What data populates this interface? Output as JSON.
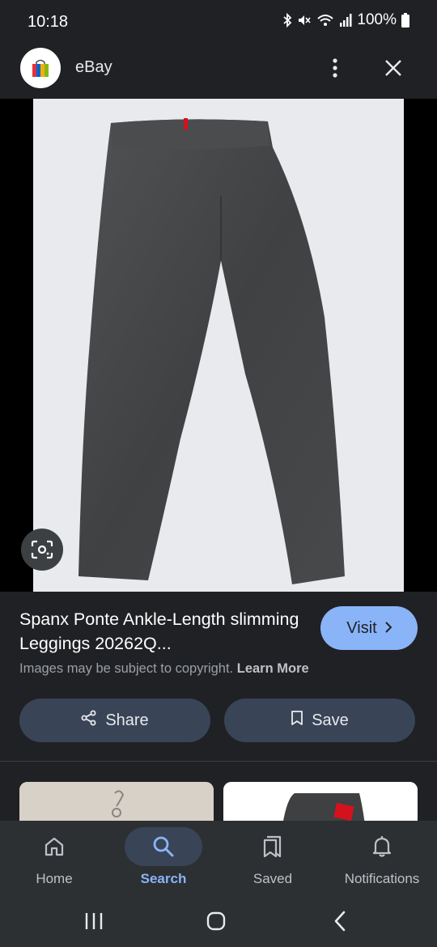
{
  "status_bar": {
    "time": "10:18",
    "battery": "100%",
    "icons": [
      "bluetooth-icon",
      "mute-icon",
      "wifi-icon",
      "signal-icon",
      "battery-icon"
    ]
  },
  "header": {
    "app_name": "eBay",
    "icons": [
      "ebay-logo",
      "more-vert-icon",
      "close-icon"
    ]
  },
  "result": {
    "title": "Spanx Ponte Ankle-Length slimming Leggings 20262Q...",
    "visit_label": "Visit",
    "copyright_text": "Images may be subject to copyright.",
    "learn_more": "Learn More",
    "share_label": "Share",
    "save_label": "Save"
  },
  "bottom_nav": {
    "items": [
      {
        "label": "Home",
        "icon": "home-icon",
        "active": false
      },
      {
        "label": "Search",
        "icon": "search-icon",
        "active": true
      },
      {
        "label": "Saved",
        "icon": "saved-icon",
        "active": false
      },
      {
        "label": "Notifications",
        "icon": "bell-icon",
        "active": false
      }
    ]
  },
  "colors": {
    "background": "#202124",
    "accent": "#8ab4f8",
    "button_bg": "#394457",
    "nav_bg": "#2d3033"
  }
}
